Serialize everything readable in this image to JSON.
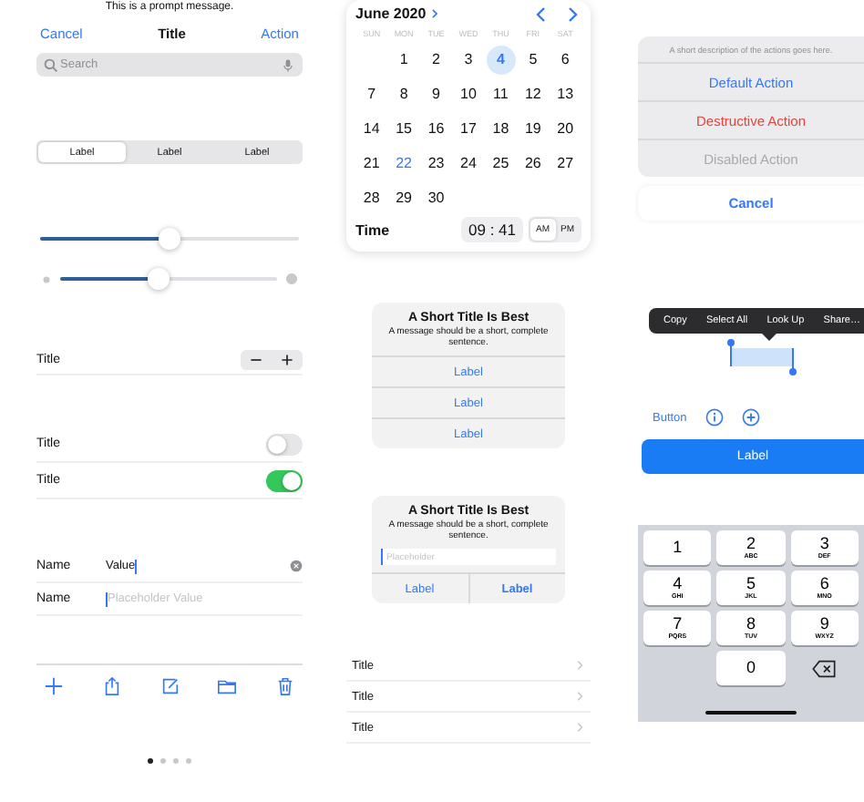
{
  "prompt_message": "This is a prompt message.",
  "nav_bar": {
    "left": "Cancel",
    "title": "Title",
    "right": "Action"
  },
  "search": {
    "placeholder": "Search"
  },
  "segmented_control": [
    {
      "label": "Label",
      "selected": true
    },
    {
      "label": "Label",
      "selected": false
    },
    {
      "label": "Label",
      "selected": false
    }
  ],
  "sliders": [
    {
      "kind": "plain",
      "level": 0.5
    },
    {
      "kind": "with_icons",
      "level": 0.45
    }
  ],
  "stepper_row": {
    "title": "Title"
  },
  "switch_rows": [
    {
      "title": "Title",
      "on": false
    },
    {
      "title": "Title",
      "on": true
    }
  ],
  "form_rows": [
    {
      "label": "Name",
      "value": "Value",
      "focused": true
    },
    {
      "label": "Name",
      "placeholder": "Placeholder Value",
      "focused": true
    }
  ],
  "page_dots": [
    {
      "selected": true
    },
    {
      "selected": false
    },
    {
      "selected": false
    },
    {
      "selected": false
    }
  ],
  "calendar": {
    "month": "June 2020",
    "weekdays": [
      "SUN",
      "MON",
      "TUE",
      "WED",
      "THU",
      "FRI",
      "SAT"
    ],
    "weeks": [
      [
        {
          "day": "1",
          "selected": false,
          "today": false
        },
        {
          "day": "2",
          "selected": false,
          "today": false
        },
        {
          "day": "3",
          "selected": false,
          "today": false
        },
        {
          "day": "4",
          "selected": true,
          "today": false
        },
        {
          "day": "5",
          "selected": false,
          "today": false
        },
        {
          "day": "6",
          "selected": false,
          "today": false
        }
      ],
      [
        {
          "day": "7",
          "selected": false,
          "today": false
        },
        {
          "day": "8",
          "selected": false,
          "today": false
        },
        {
          "day": "9",
          "selected": false,
          "today": false
        },
        {
          "day": "10",
          "selected": false,
          "today": false
        },
        {
          "day": "11",
          "selected": false,
          "today": false
        },
        {
          "day": "12",
          "selected": false,
          "today": false
        },
        {
          "day": "13",
          "selected": false,
          "today": false
        }
      ],
      [
        {
          "day": "14",
          "selected": false,
          "today": false
        },
        {
          "day": "15",
          "selected": false,
          "today": false
        },
        {
          "day": "16",
          "selected": false,
          "today": false
        },
        {
          "day": "17",
          "selected": false,
          "today": false
        },
        {
          "day": "18",
          "selected": false,
          "today": false
        },
        {
          "day": "19",
          "selected": false,
          "today": false
        },
        {
          "day": "20",
          "selected": false,
          "today": false
        }
      ],
      [
        {
          "day": "21",
          "selected": false,
          "today": false
        },
        {
          "day": "22",
          "selected": false,
          "today": true
        },
        {
          "day": "23",
          "selected": false,
          "today": false
        },
        {
          "day": "24",
          "selected": false,
          "today": false
        },
        {
          "day": "25",
          "selected": false,
          "today": false
        },
        {
          "day": "26",
          "selected": false,
          "today": false
        },
        {
          "day": "27",
          "selected": false,
          "today": false
        }
      ],
      [
        {
          "day": "28",
          "selected": false,
          "today": false
        },
        {
          "day": "29",
          "selected": false,
          "today": false
        },
        {
          "day": "30",
          "selected": false,
          "today": false
        }
      ]
    ],
    "time_label": "Time",
    "time": "09 : 41",
    "periods": [
      {
        "label": "AM",
        "selected": true
      },
      {
        "label": "PM",
        "selected": false
      }
    ]
  },
  "alert": {
    "title": "A Short Title Is Best",
    "message": "A message should be a short, complete sentence.",
    "actions": [
      {
        "label": "Label",
        "bold": false
      },
      {
        "label": "Label",
        "bold": false
      },
      {
        "label": "Label",
        "bold": false
      }
    ]
  },
  "input_alert": {
    "title": "A Short Title Is Best",
    "message": "A message should be a short, complete sentence.",
    "field": {
      "placeholder": "Placeholder"
    },
    "actions": [
      {
        "label": "Label",
        "bold": false
      },
      {
        "label": "Label",
        "bold": true
      }
    ]
  },
  "list": [
    {
      "title": "Title"
    },
    {
      "title": "Title"
    },
    {
      "title": "Title"
    }
  ],
  "action_sheet": {
    "description": "A short description of the actions goes here.",
    "actions": [
      {
        "label": "Default Action",
        "kind": "default"
      },
      {
        "label": "Destructive Action",
        "kind": "destructive"
      },
      {
        "label": "Disabled Action",
        "kind": "disabled"
      }
    ],
    "cancel": "Cancel"
  },
  "edit_menu": [
    "Copy",
    "Select All",
    "Look Up",
    "Share…"
  ],
  "text_button": "Button",
  "filled_button": "Label",
  "keypad": [
    {
      "digit": "1"
    },
    {
      "digit": "2",
      "letters": "ABC"
    },
    {
      "digit": "3",
      "letters": "DEF"
    },
    {
      "digit": "4",
      "letters": "GHI"
    },
    {
      "digit": "5",
      "letters": "JKL"
    },
    {
      "digit": "6",
      "letters": "MNO"
    },
    {
      "digit": "7",
      "letters": "PQRS"
    },
    {
      "digit": "8",
      "letters": "TUV"
    },
    {
      "digit": "9",
      "letters": "WXYZ"
    },
    {
      "digit": "0"
    }
  ]
}
